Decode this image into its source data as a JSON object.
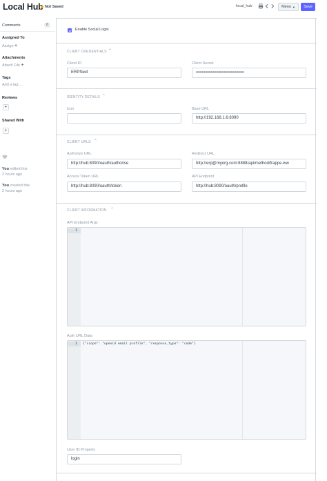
{
  "header": {
    "title": "Local Hub",
    "status": "Not Saved",
    "doc_name": "local_hub",
    "menu_label": "Menu",
    "save_label": "Save"
  },
  "sidebar": {
    "comments_label": "Comments",
    "comments_count": "0",
    "assigned_to": "Assigned To",
    "assign": "Assign",
    "attachments": "Attachments",
    "attach_file": "Attach File",
    "tags": "Tags",
    "add_tag": "Add a tag ...",
    "reviews": "Reviews",
    "shared_with": "Shared With",
    "activity": [
      {
        "who": "You",
        "action": "edited this",
        "when": "2 hours ago"
      },
      {
        "who": "You",
        "action": "created this",
        "when": "2 hours ago"
      }
    ]
  },
  "form": {
    "enable_social_login": "Enable Social Login",
    "sections": {
      "credentials": "CLIENT CREDENTIALS",
      "identity": "IDENTITY DETAILS",
      "urls": "CLIENT URLS",
      "info": "CLIENT INFORMATION"
    },
    "client_id": {
      "label": "Client ID",
      "value": "ERPNext"
    },
    "client_secret": {
      "label": "Client Secret",
      "value": "••••••••••••••••••••••••••••••••••••••••••••••••"
    },
    "icon": {
      "label": "Icon",
      "value": ""
    },
    "base_url": {
      "label": "Base URL",
      "value": "http://192.168.1.6:8090"
    },
    "authorize_url": {
      "label": "Authorize URL",
      "value": "http://hub:8090/oauth/authorise"
    },
    "redirect_url": {
      "label": "Redirect URL",
      "value": "http://erp@myorg.com:8888/api/method/frappe.ww"
    },
    "access_token_url": {
      "label": "Access Token URL",
      "value": "http://hub:8090/oauth/token"
    },
    "api_endpoint": {
      "label": "API Endpoint",
      "value": "http://hub:8090/oauth/profile"
    },
    "api_endpoint_args": {
      "label": "API Endpoint Args",
      "line_no": "1",
      "value": ""
    },
    "auth_url_data": {
      "label": "Auth URL Data",
      "line_no": "1",
      "value": "{\"scope\": \"openid email profile\", \"response_type\": \"code\"}"
    },
    "user_id_property": {
      "label": "User ID Property",
      "value": "login"
    }
  }
}
